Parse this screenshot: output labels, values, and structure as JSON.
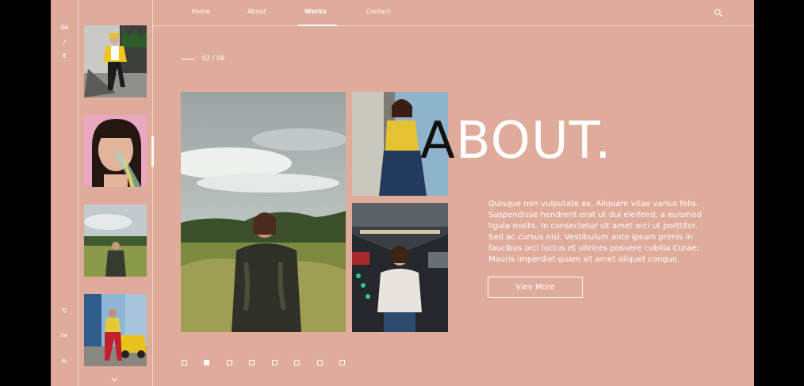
{
  "languages": [
    "de",
    "/",
    "it"
  ],
  "social": [
    "ig",
    "tw",
    "fb"
  ],
  "nav": {
    "items": [
      {
        "label": "Home"
      },
      {
        "label": "About"
      },
      {
        "label": "Works",
        "active": true
      },
      {
        "label": "Contact"
      }
    ]
  },
  "slide": {
    "counter": "02 / 08",
    "current": 2,
    "dots": 8
  },
  "hero": {
    "title_first": "A",
    "title_rest": "BOUT.",
    "body": "Quisque non vulputate ex. Aliquam vitae varius felis. Suspendisse hendrerit erat ut dui eleifend, a euismod ligula mollis. In consectetur sit amet orci ut porttitor. Sed ac cursus nisi. Vestibulum ante ipsum primis in faucibus orci luctus et ultrices posuere cubilia Curae; Mauris imperdiet quam sit amet aliquet congue.",
    "button": "Viev More"
  },
  "colors": {
    "background": "#dfab9a",
    "accent": "#ffffff",
    "title_first": "#111111"
  },
  "icons": {
    "search": "search-icon",
    "scroll": "chevron-down-icon"
  }
}
